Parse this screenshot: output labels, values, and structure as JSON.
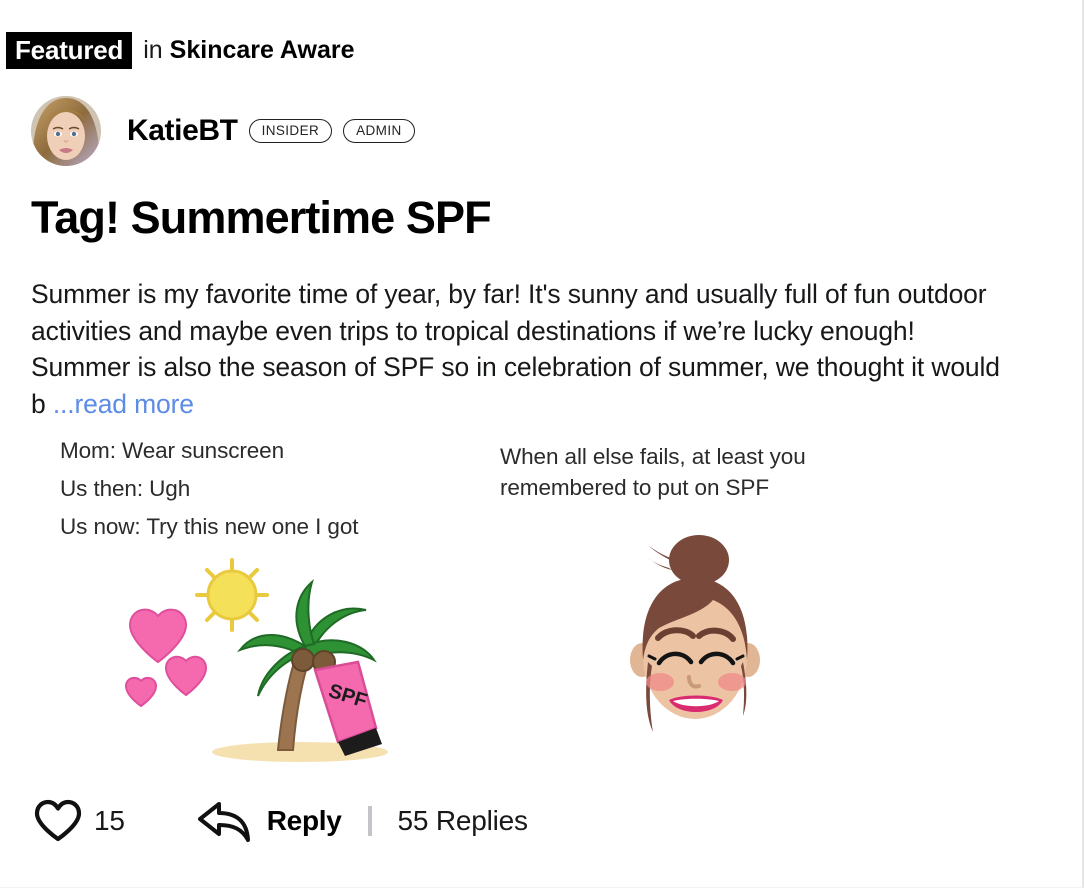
{
  "header": {
    "featured_label": "Featured",
    "in_label": "in",
    "group_name": "Skincare Aware"
  },
  "author": {
    "name": "KatieBT",
    "badges": [
      {
        "label": "INSIDER"
      },
      {
        "label": "ADMIN"
      }
    ],
    "avatar_alt": "avatar-photo"
  },
  "post": {
    "title": "Tag! Summertime SPF",
    "body_text": "Summer is my favorite time of year, by far! It's sunny and usually full of fun outdoor activities and maybe even trips to tropical destinations if we’re lucky enough! Summer is also the season of SPF so in celebration of summer, we thought it would b",
    "read_more_label": "...read more"
  },
  "memes": [
    {
      "id": "meme-left",
      "lines": [
        "Mom: Wear sunscreen",
        "Us then: Ugh",
        "Us now: Try this new one I got"
      ],
      "art_label": "hearts-sun-palm-spf-bottle-emoji",
      "spf_bottle_text": "SPF"
    },
    {
      "id": "meme-right",
      "lines": [
        "When all else fails, at least you",
        "remembered to put on SPF"
      ],
      "art_label": "smiling-woman-hair-bun-emoji"
    }
  ],
  "actions": {
    "like_icon": "heart-outline-icon",
    "like_count": "15",
    "reply_icon": "reply-arrow-icon",
    "reply_label": "Reply",
    "replies_count_label": "55 Replies"
  },
  "colors": {
    "link_blue": "#5d8ce6",
    "badge_black": "#000000",
    "divider_gray": "#c2c4c8",
    "heart_pink": "#f56aaf",
    "sun_yellow": "#f5e05a",
    "palm_green": "#2e9134",
    "trunk_brown": "#9c7550",
    "skin_tone": "#e0b695",
    "hair_brown": "#79493b",
    "lip_pink": "#d92b6f"
  }
}
